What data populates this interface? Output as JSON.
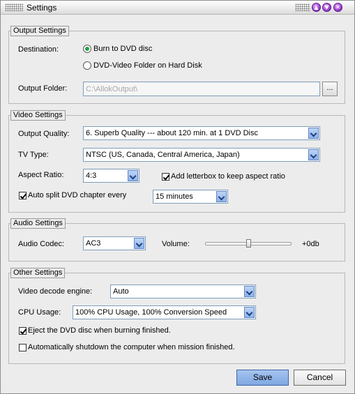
{
  "window": {
    "title": "Settings"
  },
  "output": {
    "legend": "Output Settings",
    "destination_label": "Destination:",
    "options": [
      "Burn to DVD disc",
      "DVD-Video Folder on Hard Disk"
    ],
    "selected_option": 0,
    "folder_label": "Output Folder:",
    "folder_value": "C:\\AllokOutput\\",
    "browse_label": "..."
  },
  "video": {
    "legend": "Video Settings",
    "quality_label": "Output Quality:",
    "quality_value": "6. Superb Quality --- about 120 min. at 1 DVD Disc",
    "tvtype_label": "TV Type:",
    "tvtype_value": "NTSC (US, Canada, Central America, Japan)",
    "aspect_label": "Aspect Ratio:",
    "aspect_value": "4:3",
    "letterbox_label": "Add letterbox to keep aspect ratio",
    "letterbox_checked": true,
    "autosplit_label": "Auto split DVD chapter every",
    "autosplit_checked": true,
    "split_value": "15 minutes"
  },
  "audio": {
    "legend": "Audio Settings",
    "codec_label": "Audio Codec:",
    "codec_value": "AC3",
    "volume_label": "Volume:",
    "volume_value": "+0db",
    "volume_level": 0.5
  },
  "other": {
    "legend": "Other Settings",
    "decode_label": "Video decode engine:",
    "decode_value": "Auto",
    "cpu_label": "CPU Usage:",
    "cpu_value": "100% CPU Usage, 100% Conversion Speed",
    "eject_label": "Eject the DVD disc when burning finished.",
    "eject_checked": true,
    "shutdown_label": "Automatically shutdown the computer when  mission finished.",
    "shutdown_checked": false
  },
  "footer": {
    "save_label": "Save",
    "cancel_label": "Cancel"
  },
  "colors": {
    "accent": "#7ea8e1",
    "radio_selected": "#26a24a",
    "titlebar_button": "#9b3fd0"
  }
}
